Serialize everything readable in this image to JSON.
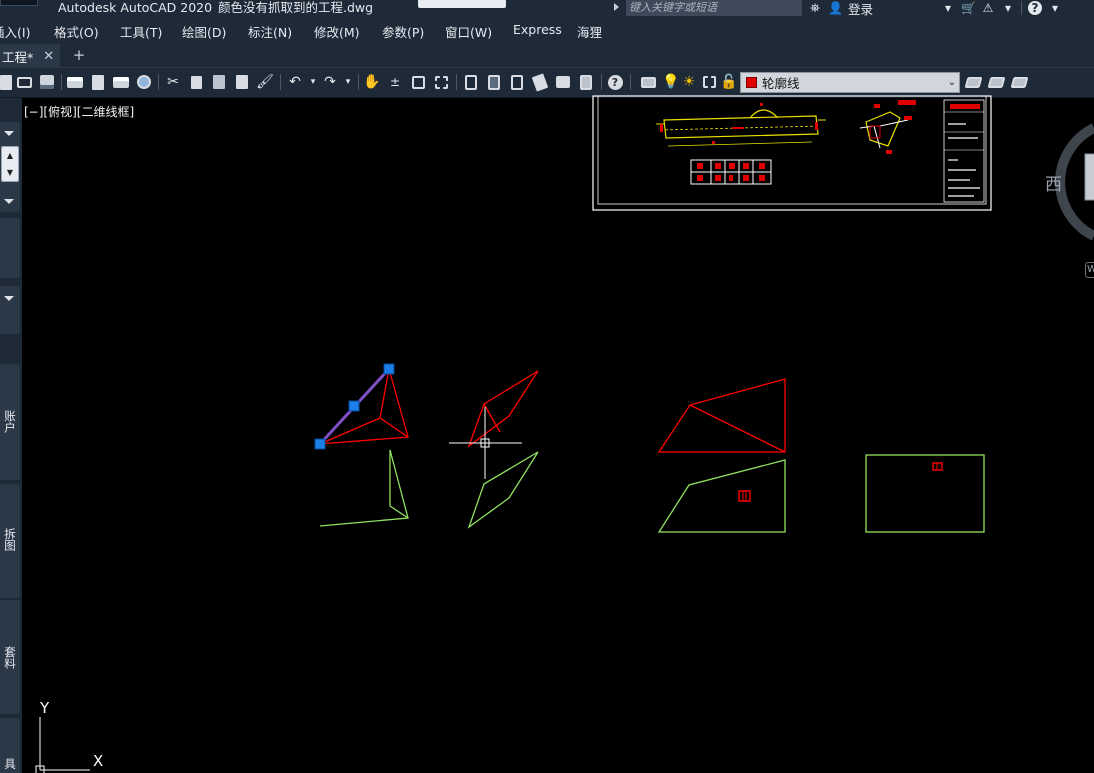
{
  "titlebar": {
    "app_title": "Autodesk AutoCAD 2020",
    "file_title": "颜色没有抓取到的工程.dwg",
    "search_placeholder": "键入关键字或短语",
    "login_label": "登录"
  },
  "menu": {
    "items": [
      "插入(I)",
      "格式(O)",
      "工具(T)",
      "绘图(D)",
      "标注(N)",
      "修改(M)",
      "参数(P)",
      "窗口(W)",
      "Express",
      "海狸"
    ],
    "first_visible": "插入(I)"
  },
  "tabs": {
    "active_label": "工程*",
    "close_glyph": "✕",
    "add_glyph": "+"
  },
  "toolbar": {
    "layer_name": "轮廓线",
    "layer_color": "#e00000"
  },
  "viewport": {
    "label": "[−][俯视][二维线框]",
    "viewcube_direction": "西",
    "wcs_label": "W",
    "ucs_x": "X",
    "ucs_y": "Y"
  },
  "left_palette": {
    "tabs": [
      "账户",
      "拆图",
      "套料",
      "具"
    ]
  },
  "colors": {
    "background": "#000000",
    "chrome": "#1f2a38",
    "red_lines": "#ff0000",
    "green_lines": "#8fe060",
    "yellow_lines": "#e8e000",
    "grip_blue": "#1a7fe8"
  }
}
